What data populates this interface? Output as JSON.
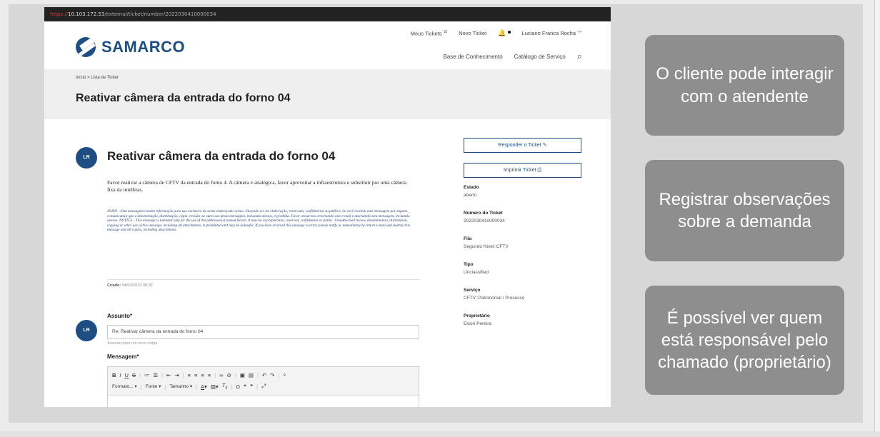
{
  "browser": {
    "url_scheme": "https://",
    "url_host": "10.103.172.53",
    "url_path": "/external/ticket/number/2022030410000034"
  },
  "header": {
    "logo_text": "SAMARCO",
    "top_nav": {
      "my_tickets": "Meus Tickets",
      "my_tickets_count": "10",
      "new_ticket": "Novo Ticket",
      "user_name": "Luciano Franca Rocha"
    },
    "sec_nav": {
      "knowledge_base": "Base de Conhecimento",
      "service_catalog": "Catálogo de Serviço"
    }
  },
  "breadcrumb": {
    "home": "Início",
    "separator": ">",
    "current": "Lista de Ticket"
  },
  "page_title": "Reativar câmera da entrada do forno 04",
  "ticket": {
    "avatar_initials": "LR",
    "title": "Reativar câmera da entrada do forno 04",
    "description": "Favor reativar a câmera de CFTV da entrada do forno 4. A câmera é analógica, favor aproveitar a infraestrutura e substituir por uma câmera fixa da intelbras.",
    "notice": "AVISO - Esta mensagem contém informação para uso exclusivo do nome endereçado acima. Ela pode ser em elaboração, reservada, confidencial ou pública. Se você recebeu esta mensagem por engano, comunicamos que a disseminação, distribuição, cópia, revisão ou outro uso desta mensagem, incluindo anexos, é proibida. Favor avisar-nos retornando este e-mail e destruindo esta mensagem, incluindo anexos. NOTICE - This message is intended only for the use of the addressee(s) named herein. It may be in preparation, reserved, confidential or public. Unauthorized review, dissemination, distribution, copying or other use of this message, including all attachments, is prohibited and may be unlawful. If you have received this message in error, please notify us immediately by return e-mail and destroy this message and all copies, including attachments.",
    "created_label": "Criado:",
    "created_value": "04/03/2022 08:30"
  },
  "reply_form": {
    "avatar_initials": "LR",
    "subject_label": "Assunto*",
    "subject_value": "Re: Reativar câmera da entrada do forno 04",
    "subject_hint": "Assunto para um novo artigo.",
    "message_label": "Mensagem*",
    "toolbar_format": "Formato...",
    "toolbar_font": "Fonte",
    "toolbar_size": "Tamanho"
  },
  "sidebar": {
    "reply_button": "Responder o Ticket",
    "print_button": "Imprimir Ticket",
    "fields": [
      {
        "label": "Estado",
        "value": "aberto"
      },
      {
        "label": "Número do Ticket",
        "value": "2022030410000034"
      },
      {
        "label": "Fila",
        "value": "Segundo Nivel::CFTV"
      },
      {
        "label": "Tipo",
        "value": "Unclassified"
      },
      {
        "label": "Serviço",
        "value": "CFTV::Patrimonial / Processo"
      },
      {
        "label": "Proprietário",
        "value": "Elson Pereira"
      }
    ]
  },
  "callouts": [
    "O cliente pode interagir com o atendente",
    "Registrar observações sobre a demanda",
    "É possível ver quem está responsável pelo chamado (proprietário)"
  ],
  "colors": {
    "brand": "#1e4d82",
    "callout_bg": "#8e8e8e",
    "url_scheme": "#e8302c"
  }
}
